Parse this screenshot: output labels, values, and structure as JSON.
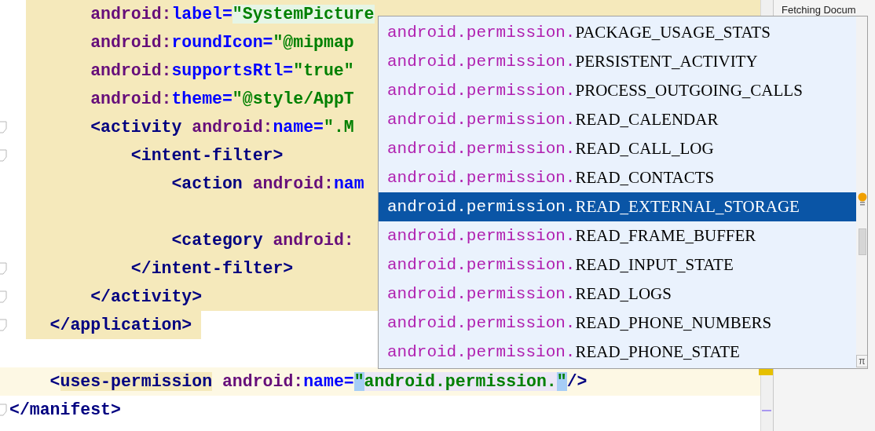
{
  "editor": {
    "lines": [
      {
        "kind": "block",
        "fold": false,
        "tokens": [
          {
            "kind": "ns",
            "text": "        android:"
          },
          {
            "kind": "attr",
            "text": "label="
          },
          {
            "kind": "value_hl",
            "text": "\"SystemPicture"
          }
        ]
      },
      {
        "kind": "block",
        "fold": false,
        "tokens": [
          {
            "kind": "ns",
            "text": "        android:"
          },
          {
            "kind": "attr",
            "text": "roundIcon="
          },
          {
            "kind": "value",
            "text": "\"@mipmap"
          }
        ]
      },
      {
        "kind": "block",
        "fold": false,
        "tokens": [
          {
            "kind": "ns",
            "text": "        android:"
          },
          {
            "kind": "attr",
            "text": "supportsRtl="
          },
          {
            "kind": "value",
            "text": "\"true\""
          }
        ]
      },
      {
        "kind": "block",
        "fold": false,
        "tokens": [
          {
            "kind": "ns",
            "text": "        android:"
          },
          {
            "kind": "attr",
            "text": "theme="
          },
          {
            "kind": "value",
            "text": "\"@style/AppT"
          }
        ]
      },
      {
        "kind": "block",
        "fold": true,
        "tokens": [
          {
            "kind": "tag",
            "text": "        <activity"
          },
          {
            "kind": "ns",
            "text": " android:"
          },
          {
            "kind": "attr",
            "text": "name="
          },
          {
            "kind": "value",
            "text": "\".M"
          }
        ]
      },
      {
        "kind": "block",
        "fold": true,
        "tokens": [
          {
            "kind": "tag",
            "text": "            <intent-filter>"
          }
        ]
      },
      {
        "kind": "block",
        "fold": false,
        "tokens": [
          {
            "kind": "tag",
            "text": "                <action"
          },
          {
            "kind": "ns",
            "text": " android:"
          },
          {
            "kind": "attr",
            "text": "nam"
          }
        ]
      },
      {
        "kind": "block",
        "fold": false
      },
      {
        "kind": "block",
        "fold": false,
        "tokens": [
          {
            "kind": "tag",
            "text": "                <category"
          },
          {
            "kind": "ns",
            "text": " android:"
          }
        ]
      },
      {
        "kind": "block",
        "fold": true,
        "tokens": [
          {
            "kind": "tag",
            "text": "            </intent-filter>"
          }
        ]
      },
      {
        "kind": "block",
        "fold": true,
        "tokens": [
          {
            "kind": "tag",
            "text": "        </activity>"
          }
        ]
      },
      {
        "kind": "block_end",
        "fold": true,
        "tokens": [
          {
            "kind": "tag",
            "text": "    </application>"
          }
        ]
      },
      {
        "kind": "plain",
        "fold": false
      },
      {
        "kind": "current",
        "fold": false,
        "tokens": [
          {
            "kind": "tag",
            "text": "    <"
          },
          {
            "kind": "tag_hl",
            "text": "uses-permission"
          },
          {
            "kind": "ns",
            "text": " android:"
          },
          {
            "kind": "attr",
            "text": "name="
          },
          {
            "kind": "quote_hl",
            "text": "\""
          },
          {
            "kind": "value_sel",
            "text": "android.permission."
          },
          {
            "kind": "quote_hl",
            "text": "\""
          },
          {
            "kind": "tag",
            "text": "/>"
          }
        ]
      },
      {
        "kind": "plain",
        "fold": true,
        "tokens": [
          {
            "kind": "tag",
            "text": "</manifest>"
          }
        ]
      }
    ]
  },
  "completion": {
    "items": [
      {
        "prefix": "android.permission.",
        "name": "PACKAGE_USAGE_STATS",
        "selected": false
      },
      {
        "prefix": "android.permission.",
        "name": "PERSISTENT_ACTIVITY",
        "selected": false
      },
      {
        "prefix": "android.permission.",
        "name": "PROCESS_OUTGOING_CALLS",
        "selected": false
      },
      {
        "prefix": "android.permission.",
        "name": "READ_CALENDAR",
        "selected": false
      },
      {
        "prefix": "android.permission.",
        "name": "READ_CALL_LOG",
        "selected": false
      },
      {
        "prefix": "android.permission.",
        "name": "READ_CONTACTS",
        "selected": false
      },
      {
        "prefix": "android.permission.",
        "name": "READ_EXTERNAL_STORAGE",
        "selected": true
      },
      {
        "prefix": "android.permission.",
        "name": "READ_FRAME_BUFFER",
        "selected": false
      },
      {
        "prefix": "android.permission.",
        "name": "READ_INPUT_STATE",
        "selected": false
      },
      {
        "prefix": "android.permission.",
        "name": "READ_LOGS",
        "selected": false
      },
      {
        "prefix": "android.permission.",
        "name": "READ_PHONE_NUMBERS",
        "selected": false
      },
      {
        "prefix": "android.permission.",
        "name": "READ_PHONE_STATE",
        "selected": false
      }
    ],
    "corner": "π"
  },
  "side_panel": {
    "text": "Fetching Docum"
  }
}
